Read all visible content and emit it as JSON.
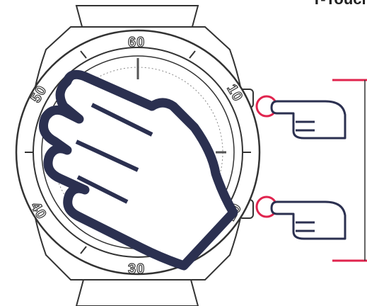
{
  "header": {
    "title": "T-Touch"
  },
  "bezel": {
    "labels": [
      "60",
      "10",
      "20",
      "30",
      "40",
      "50"
    ]
  },
  "colors": {
    "hand": "#2b3050",
    "button_ring": "#e0244e",
    "indicator": "#e0244e",
    "outline": "#333333"
  },
  "icons": [
    "full-hand-icon",
    "finger-press-top-icon",
    "finger-press-bottom-icon"
  ]
}
